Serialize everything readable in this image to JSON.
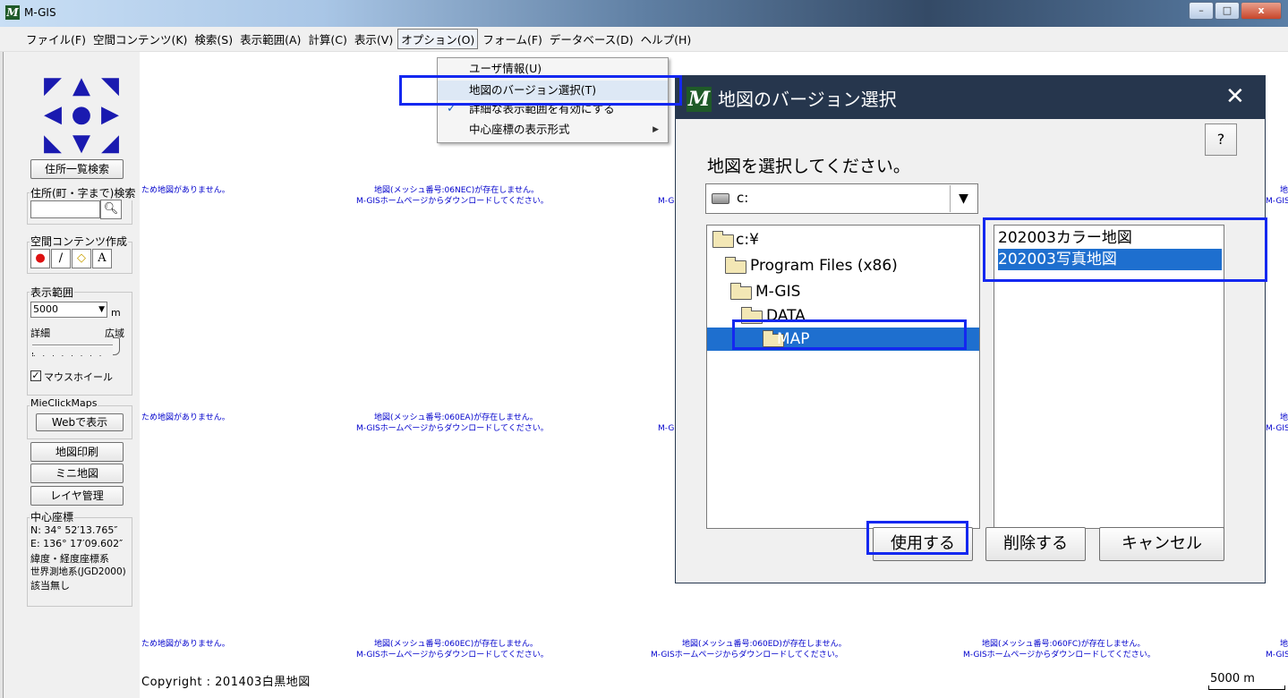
{
  "window": {
    "title": "M-GIS",
    "icon_letter": "M",
    "buttons": {
      "minimize": "–",
      "maximize": "□",
      "close": "x"
    }
  },
  "menubar": {
    "items": [
      "ファイル(F)",
      "空間コンテンツ(K)",
      "検索(S)",
      "表示範囲(A)",
      "計算(C)",
      "表示(V)",
      "オプション(O)",
      "フォーム(F)",
      "データベース(D)",
      "ヘルプ(H)"
    ]
  },
  "option_menu": {
    "items": [
      {
        "label": "ユーザ情報(U)"
      },
      {
        "label": "地図のバージョン選択(T)",
        "highlighted": true
      },
      {
        "label": "詳細な表示範囲を有効にする",
        "checked": true
      },
      {
        "label": "中心座標の表示形式",
        "submenu": true
      }
    ],
    "check_icon": "checkmark-icon",
    "submenu_icon": "triangle-right-icon"
  },
  "left_panel": {
    "nav_icons": [
      "arrow-up-left-icon",
      "arrow-up-icon",
      "arrow-up-right-icon",
      "arrow-left-icon",
      "center-dot-icon",
      "arrow-right-icon",
      "arrow-down-left-icon",
      "arrow-down-icon",
      "arrow-down-right-icon"
    ],
    "address_list_button": "住所一覧検索",
    "address_search_label": "住所(町・字まで)検索",
    "search_icon": "magnifier-icon",
    "content_create_label": "空間コンテンツ作成",
    "content_tools": [
      "pin-icon",
      "line-icon",
      "polygon-icon",
      "A"
    ],
    "range_label": "表示範囲",
    "range_value": "5000",
    "range_unit": "m",
    "slider_left": "詳細",
    "slider_right": "広域",
    "slider_value": 1.0,
    "mouse_wheel_label": "マウスホイール",
    "mouse_wheel_checked": true,
    "mieclick_label": "MieClickMaps",
    "web_button": "Webで表示",
    "print_button": "地図印刷",
    "mini_map_button": "ミニ地図",
    "layer_button": "レイヤ管理",
    "center_label": "中心座標",
    "coord_n": "N:  34°  52′13.765″",
    "coord_e": "E:  136°  17′09.602″",
    "coord_system": "緯度・経度座標系",
    "datum": "世界測地系(JGD2000)",
    "zone": "該当無し"
  },
  "map": {
    "no_map_fragment": "ため地図がありません。",
    "download_text": "M-GISホームページからダウンロードしてください。",
    "missing_06NEC": "地図(メッシュ番号:06NEC)が存在しません。",
    "missing_060EA": "地図(メッシュ番号:060EA)が存在しません。",
    "missing_060EC": "地図(メッシュ番号:060EC)が存在しません。",
    "missing_060ED": "地図(メッシュ番号:060ED)が存在しません。",
    "missing_060FC": "地図(メッシュ番号:060FC)が存在しません。",
    "fragment_mg": "M-G",
    "fragment_mgis": "M-GIS",
    "fragment_chi": "地",
    "copyright": "Copyright : 201403白黒地図",
    "scale": "5000 m"
  },
  "dialog": {
    "title": "地図のバージョン選択",
    "icon_letter": "M",
    "close_icon": "close-x-icon",
    "help": "?",
    "prompt": "地図を選択してください。",
    "drive": "c:",
    "drive_icon": "drive-icon",
    "dropdown_icon": "triangle-down-icon",
    "directories": [
      {
        "name": "c:¥"
      },
      {
        "name": "Program Files (x86)"
      },
      {
        "name": "M-GIS"
      },
      {
        "name": "DATA"
      },
      {
        "name": "MAP",
        "selected": true
      }
    ],
    "folder_icon": "folder-icon",
    "files": [
      {
        "name": "202003カラー地図"
      },
      {
        "name": "202003写真地図",
        "selected": true
      }
    ],
    "buttons": {
      "use": "使用する",
      "delete": "削除する",
      "cancel": "キャンセル"
    }
  },
  "colors": {
    "highlight_box": "#1428f0",
    "selection": "#1e6fcf",
    "dialog_title_bar": "#26364d",
    "map_text": "#0000cc",
    "nav_arrows": "#1a1ab0"
  }
}
